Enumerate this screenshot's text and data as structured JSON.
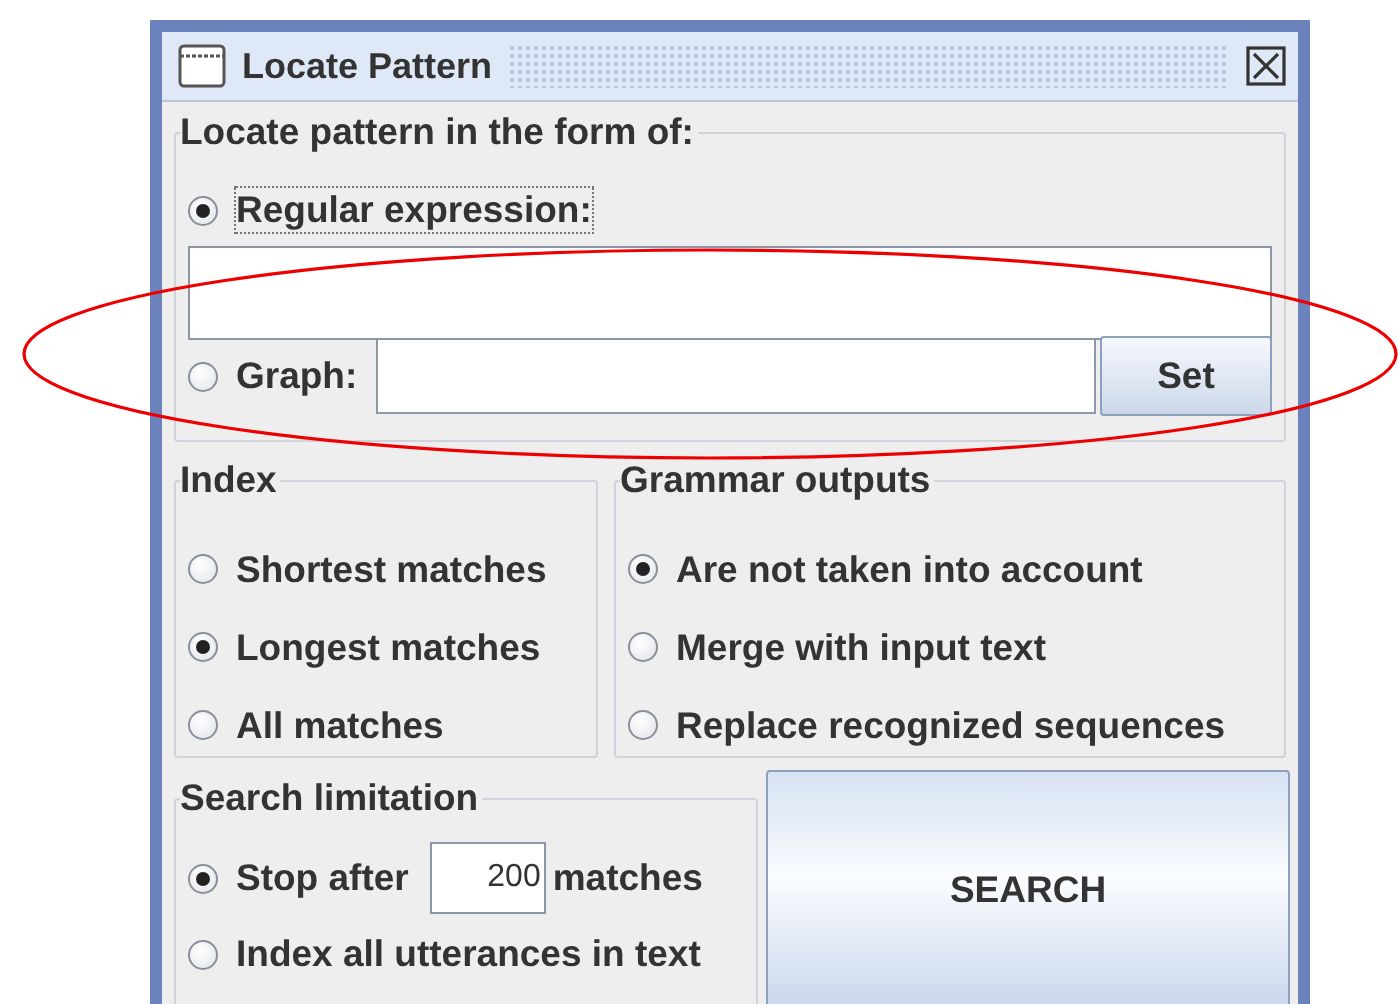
{
  "window": {
    "title": "Locate Pattern"
  },
  "pattern": {
    "legend": "Locate pattern in the form of:",
    "options": [
      {
        "kind": "regex",
        "label": "Regular expression:",
        "selected": true,
        "focused": true
      },
      {
        "kind": "graph",
        "label": "Graph:",
        "selected": false,
        "focused": false
      }
    ],
    "set_button": "Set"
  },
  "index": {
    "legend": "Index",
    "options": [
      {
        "label": "Shortest matches",
        "selected": false
      },
      {
        "label": "Longest matches",
        "selected": true
      },
      {
        "label": "All matches",
        "selected": false
      }
    ]
  },
  "grammar_outputs": {
    "legend": "Grammar outputs",
    "options": [
      {
        "label": "Are not taken into account",
        "selected": true
      },
      {
        "label": "Merge with input text",
        "selected": false
      },
      {
        "label": "Replace recognized sequences",
        "selected": false
      }
    ]
  },
  "search_limitation": {
    "legend": "Search limitation",
    "options": [
      {
        "kind": "limit",
        "label": "Stop after",
        "value": "200",
        "suffix": "matches",
        "selected": true
      },
      {
        "kind": "plain",
        "label": "Index all utterances in text",
        "selected": false
      }
    ]
  },
  "search_button": "SEARCH"
}
